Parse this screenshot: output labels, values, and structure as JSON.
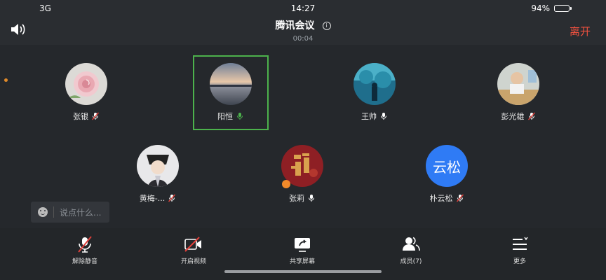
{
  "status_bar": {
    "network": "3G",
    "time": "14:27",
    "battery": "94%",
    "battery_level": 0.94
  },
  "header": {
    "title": "腾讯会议",
    "duration": "00:04",
    "leave_label": "离开"
  },
  "participants": [
    {
      "name": "张银",
      "avatar": "rose-photo",
      "mic": "muted"
    },
    {
      "name": "阳恒",
      "avatar": "sunset-photo",
      "mic": "speaking",
      "selected": true
    },
    {
      "name": "王帅",
      "avatar": "aquarium-photo",
      "mic": "on"
    },
    {
      "name": "彭光雄",
      "avatar": "child-photo",
      "mic": "muted"
    },
    {
      "name": "黄梅-...",
      "avatar": "costume-photo",
      "mic": "muted"
    },
    {
      "name": "张莉",
      "avatar": "fu-character-photo",
      "mic": "on",
      "host_badge": true
    },
    {
      "name": "朴云松",
      "avatar_text": "云松",
      "avatar_color": "#2f7bf5",
      "mic": "muted"
    }
  ],
  "chat": {
    "placeholder": "说点什么..."
  },
  "toolbar": {
    "unmute_label": "解除静音",
    "video_label": "开启视频",
    "share_label": "共享屏幕",
    "members_label": "成员(7)",
    "more_label": "更多"
  },
  "colors": {
    "leave": "#f0513f",
    "active": "#4cb24c",
    "accent_blue": "#2f7bf5",
    "mute_red": "#e0403a"
  }
}
